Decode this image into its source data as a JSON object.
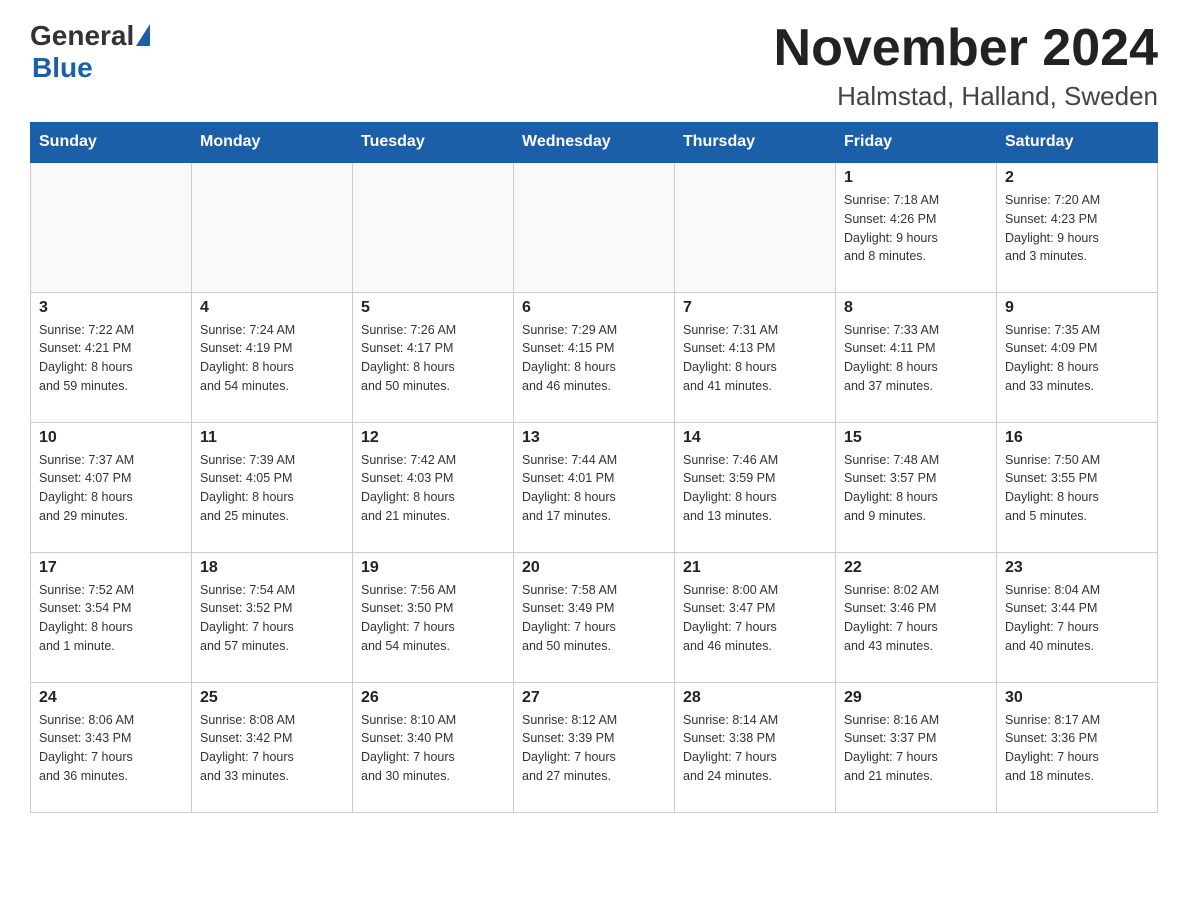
{
  "header": {
    "logo_general": "General",
    "logo_blue": "Blue",
    "month_title": "November 2024",
    "location": "Halmstad, Halland, Sweden"
  },
  "days_of_week": [
    "Sunday",
    "Monday",
    "Tuesday",
    "Wednesday",
    "Thursday",
    "Friday",
    "Saturday"
  ],
  "weeks": [
    [
      {
        "day": "",
        "info": ""
      },
      {
        "day": "",
        "info": ""
      },
      {
        "day": "",
        "info": ""
      },
      {
        "day": "",
        "info": ""
      },
      {
        "day": "",
        "info": ""
      },
      {
        "day": "1",
        "info": "Sunrise: 7:18 AM\nSunset: 4:26 PM\nDaylight: 9 hours\nand 8 minutes."
      },
      {
        "day": "2",
        "info": "Sunrise: 7:20 AM\nSunset: 4:23 PM\nDaylight: 9 hours\nand 3 minutes."
      }
    ],
    [
      {
        "day": "3",
        "info": "Sunrise: 7:22 AM\nSunset: 4:21 PM\nDaylight: 8 hours\nand 59 minutes."
      },
      {
        "day": "4",
        "info": "Sunrise: 7:24 AM\nSunset: 4:19 PM\nDaylight: 8 hours\nand 54 minutes."
      },
      {
        "day": "5",
        "info": "Sunrise: 7:26 AM\nSunset: 4:17 PM\nDaylight: 8 hours\nand 50 minutes."
      },
      {
        "day": "6",
        "info": "Sunrise: 7:29 AM\nSunset: 4:15 PM\nDaylight: 8 hours\nand 46 minutes."
      },
      {
        "day": "7",
        "info": "Sunrise: 7:31 AM\nSunset: 4:13 PM\nDaylight: 8 hours\nand 41 minutes."
      },
      {
        "day": "8",
        "info": "Sunrise: 7:33 AM\nSunset: 4:11 PM\nDaylight: 8 hours\nand 37 minutes."
      },
      {
        "day": "9",
        "info": "Sunrise: 7:35 AM\nSunset: 4:09 PM\nDaylight: 8 hours\nand 33 minutes."
      }
    ],
    [
      {
        "day": "10",
        "info": "Sunrise: 7:37 AM\nSunset: 4:07 PM\nDaylight: 8 hours\nand 29 minutes."
      },
      {
        "day": "11",
        "info": "Sunrise: 7:39 AM\nSunset: 4:05 PM\nDaylight: 8 hours\nand 25 minutes."
      },
      {
        "day": "12",
        "info": "Sunrise: 7:42 AM\nSunset: 4:03 PM\nDaylight: 8 hours\nand 21 minutes."
      },
      {
        "day": "13",
        "info": "Sunrise: 7:44 AM\nSunset: 4:01 PM\nDaylight: 8 hours\nand 17 minutes."
      },
      {
        "day": "14",
        "info": "Sunrise: 7:46 AM\nSunset: 3:59 PM\nDaylight: 8 hours\nand 13 minutes."
      },
      {
        "day": "15",
        "info": "Sunrise: 7:48 AM\nSunset: 3:57 PM\nDaylight: 8 hours\nand 9 minutes."
      },
      {
        "day": "16",
        "info": "Sunrise: 7:50 AM\nSunset: 3:55 PM\nDaylight: 8 hours\nand 5 minutes."
      }
    ],
    [
      {
        "day": "17",
        "info": "Sunrise: 7:52 AM\nSunset: 3:54 PM\nDaylight: 8 hours\nand 1 minute."
      },
      {
        "day": "18",
        "info": "Sunrise: 7:54 AM\nSunset: 3:52 PM\nDaylight: 7 hours\nand 57 minutes."
      },
      {
        "day": "19",
        "info": "Sunrise: 7:56 AM\nSunset: 3:50 PM\nDaylight: 7 hours\nand 54 minutes."
      },
      {
        "day": "20",
        "info": "Sunrise: 7:58 AM\nSunset: 3:49 PM\nDaylight: 7 hours\nand 50 minutes."
      },
      {
        "day": "21",
        "info": "Sunrise: 8:00 AM\nSunset: 3:47 PM\nDaylight: 7 hours\nand 46 minutes."
      },
      {
        "day": "22",
        "info": "Sunrise: 8:02 AM\nSunset: 3:46 PM\nDaylight: 7 hours\nand 43 minutes."
      },
      {
        "day": "23",
        "info": "Sunrise: 8:04 AM\nSunset: 3:44 PM\nDaylight: 7 hours\nand 40 minutes."
      }
    ],
    [
      {
        "day": "24",
        "info": "Sunrise: 8:06 AM\nSunset: 3:43 PM\nDaylight: 7 hours\nand 36 minutes."
      },
      {
        "day": "25",
        "info": "Sunrise: 8:08 AM\nSunset: 3:42 PM\nDaylight: 7 hours\nand 33 minutes."
      },
      {
        "day": "26",
        "info": "Sunrise: 8:10 AM\nSunset: 3:40 PM\nDaylight: 7 hours\nand 30 minutes."
      },
      {
        "day": "27",
        "info": "Sunrise: 8:12 AM\nSunset: 3:39 PM\nDaylight: 7 hours\nand 27 minutes."
      },
      {
        "day": "28",
        "info": "Sunrise: 8:14 AM\nSunset: 3:38 PM\nDaylight: 7 hours\nand 24 minutes."
      },
      {
        "day": "29",
        "info": "Sunrise: 8:16 AM\nSunset: 3:37 PM\nDaylight: 7 hours\nand 21 minutes."
      },
      {
        "day": "30",
        "info": "Sunrise: 8:17 AM\nSunset: 3:36 PM\nDaylight: 7 hours\nand 18 minutes."
      }
    ]
  ]
}
